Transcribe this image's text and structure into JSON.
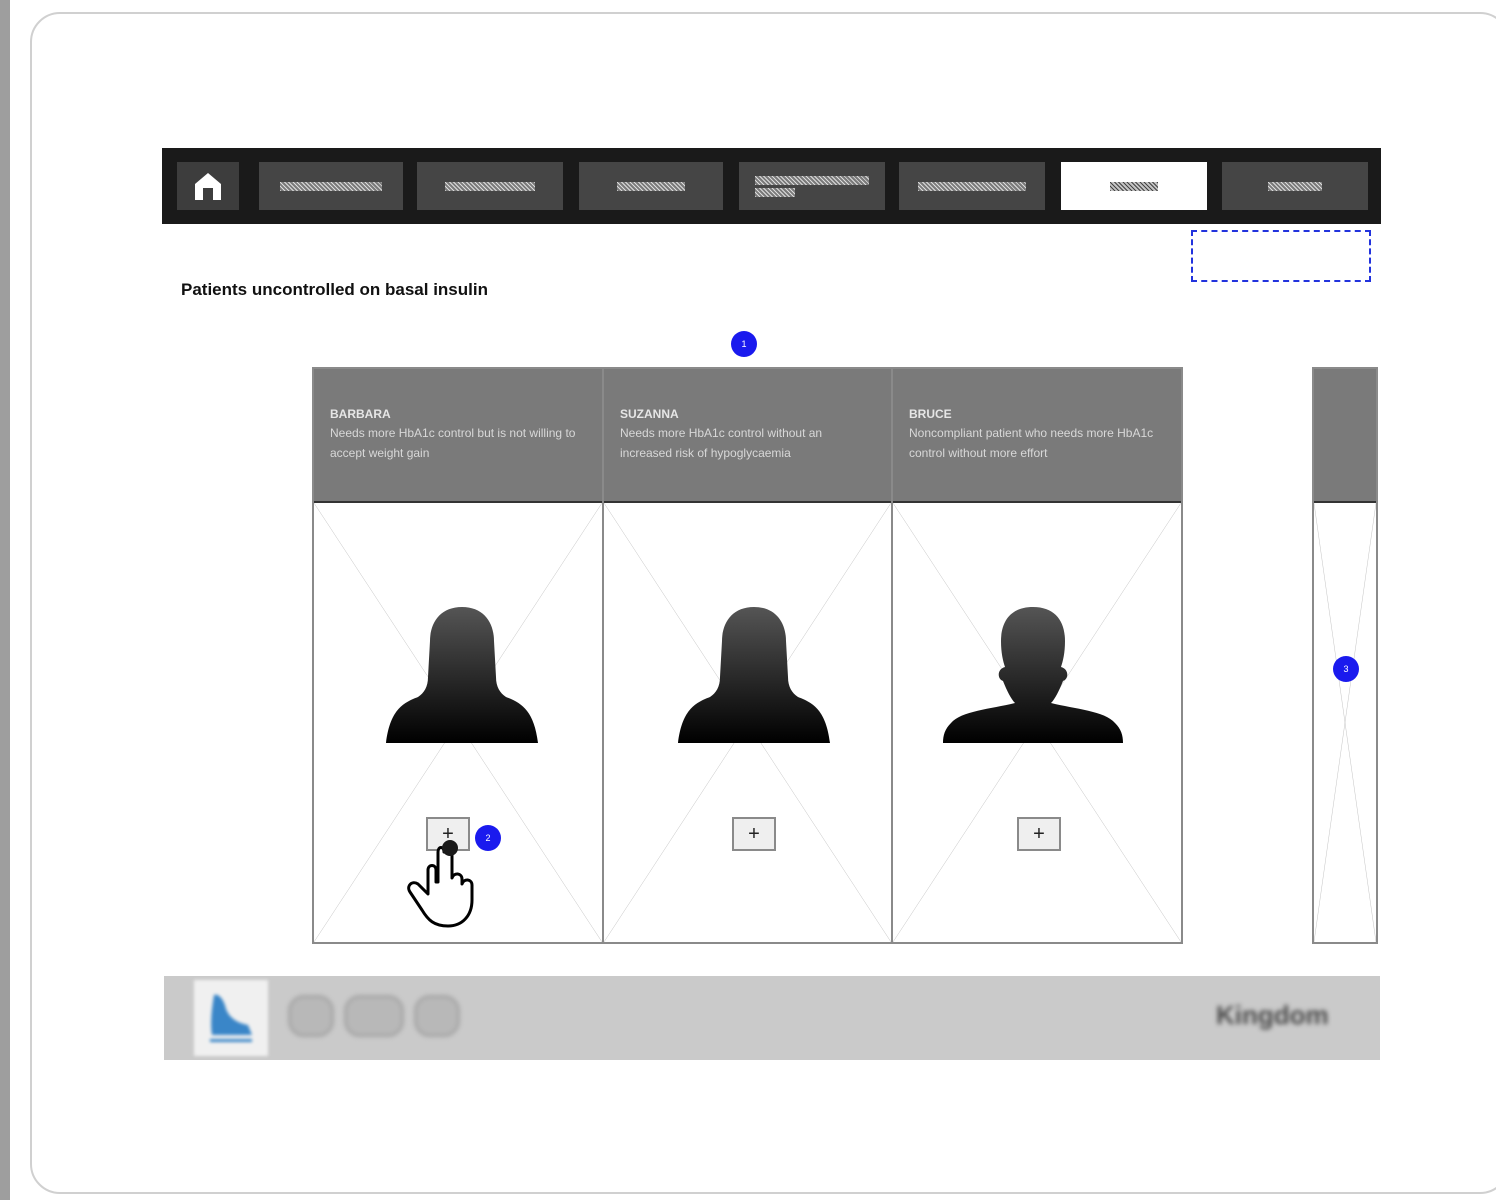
{
  "page": {
    "title": "Patients uncontrolled on basal insulin"
  },
  "nav": {
    "tabs": [
      {
        "id": "tab-1",
        "active": false
      },
      {
        "id": "tab-2",
        "active": false
      },
      {
        "id": "tab-3",
        "active": false
      },
      {
        "id": "tab-4",
        "active": false
      },
      {
        "id": "tab-5",
        "active": false
      },
      {
        "id": "tab-6",
        "active": true
      },
      {
        "id": "tab-7",
        "active": false
      }
    ],
    "home_icon": "home-icon"
  },
  "annotations": [
    "1",
    "2",
    "3"
  ],
  "patients": [
    {
      "name": "BARBARA",
      "description": "Needs more HbA1c control but is not willing to accept weight gain",
      "gender": "female"
    },
    {
      "name": "SUZANNA",
      "description": "Needs more HbA1c control without an increased risk of hypoglycaemia",
      "gender": "female"
    },
    {
      "name": "BRUCE",
      "description": "Noncompliant patient who needs more HbA1c control without more effort",
      "gender": "male"
    }
  ],
  "card_button_icon": "plus-icon",
  "cursor_icon": "hand-pointer-icon",
  "footer": {
    "logo_icon": "company-logo",
    "brand": "Kingdom"
  },
  "colors": {
    "navbar": "#1a1a1a",
    "tab": "#454545",
    "tab_active": "#ffffff",
    "card_header": "#7a7a7a",
    "annotation": "#1a1aee",
    "footer": "#cacaca"
  }
}
